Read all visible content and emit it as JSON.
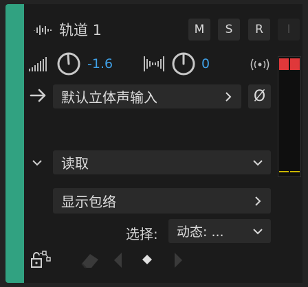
{
  "track": {
    "name": "轨道 1",
    "color": "#31a281",
    "buttons": {
      "mute": "M",
      "solo": "S",
      "record": "R",
      "input_monitor": "I"
    }
  },
  "volume": {
    "value": "-1.6",
    "icon": "volume-bars-icon"
  },
  "pan": {
    "value": "0",
    "icon": "stereo-balance-icon"
  },
  "output_icon": "broadcast-icon",
  "input": {
    "label": "默认立体声输入",
    "phase_symbol": "Ø"
  },
  "automation": {
    "mode": "读取",
    "show_envelope": "显示包络",
    "select_label": "选择:",
    "select_value": "动态: ..."
  },
  "meter": {
    "clip_color": "#e0383a",
    "level_color": "#c9b500"
  },
  "colors": {
    "accent": "#3fa0e6",
    "panel": "#1b1b1b"
  }
}
